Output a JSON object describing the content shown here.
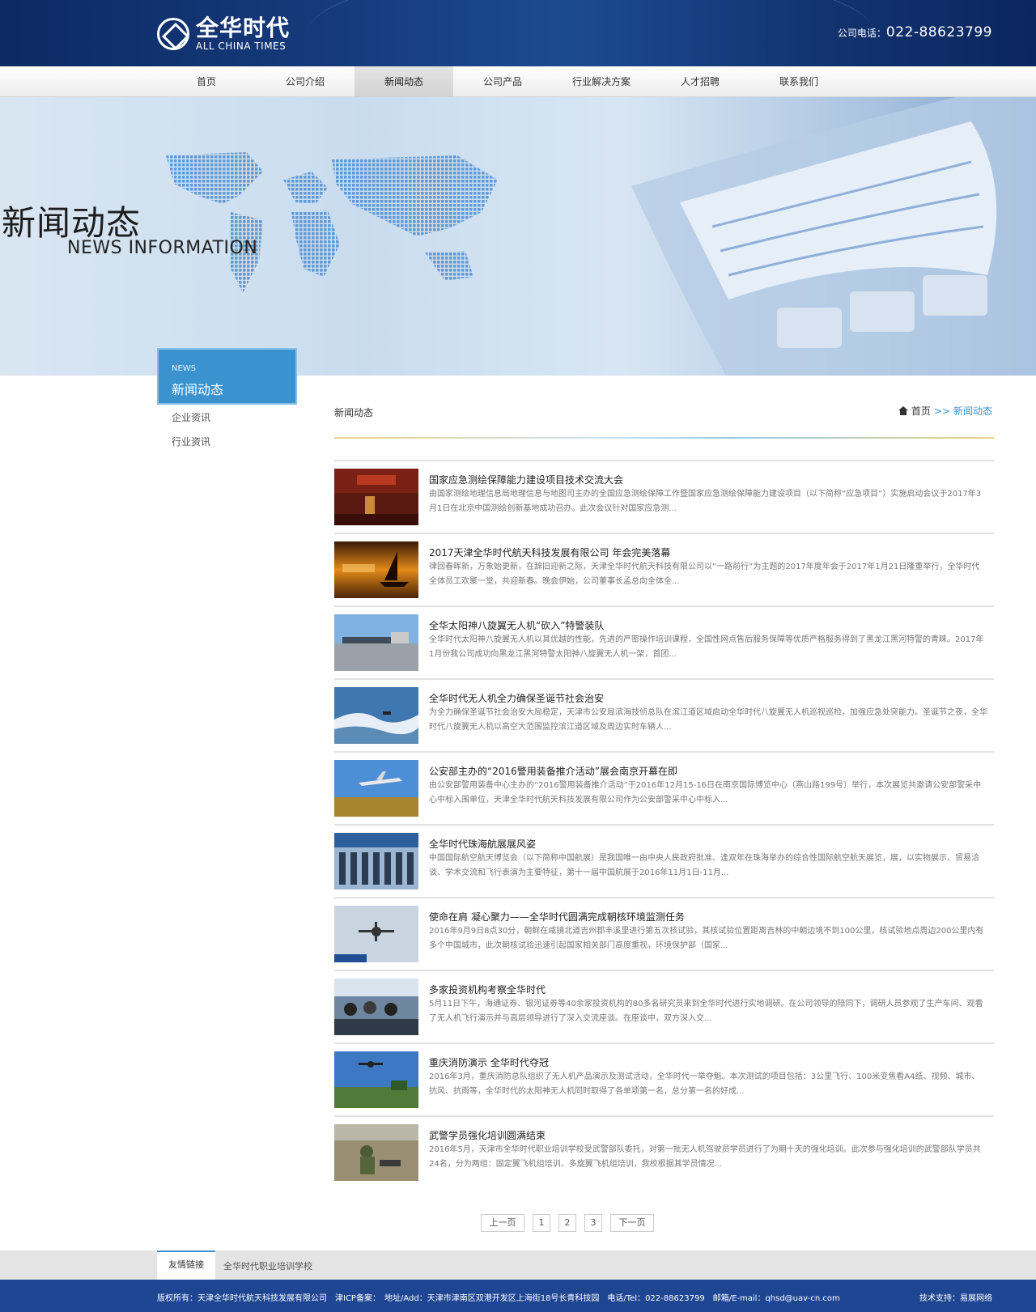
{
  "header": {
    "logo_cn": "全华时代",
    "logo_en": "ALL CHINA TIMES",
    "phone_label": "公司电话：",
    "phone_number": "022-88623799"
  },
  "nav": {
    "items": [
      {
        "label": "首页"
      },
      {
        "label": "公司介绍"
      },
      {
        "label": "新闻动态"
      },
      {
        "label": "公司产品"
      },
      {
        "label": "行业解决方案"
      },
      {
        "label": "人才招聘"
      },
      {
        "label": "联系我们"
      }
    ]
  },
  "banner": {
    "title_cn": "新闻动态",
    "title_en": "NEWS INFORMATION"
  },
  "sidebar": {
    "head_en": "NEWS",
    "head_cn": "新闻动态",
    "items": [
      {
        "label": "企业资讯"
      },
      {
        "label": "行业资讯"
      }
    ]
  },
  "content": {
    "section_title": "新闻动态",
    "breadcrumb": {
      "home": "首页",
      "sep": ">>",
      "current": "新闻动态"
    }
  },
  "news": [
    {
      "title": "国家应急测绘保障能力建设项目技术交流大会",
      "desc": "由国家测绘地理信息局地理信息与地图司主办的全国应急测绘保障工作暨国家应急测绘保障能力建设项目（以下简称“应急项目”）实施启动会议于2017年3月1日在北京中国测绘创新基地成功召办。此次会议针对国家应急测..."
    },
    {
      "title": "2017天津全华时代航天科技发展有限公司 年会完美落幕",
      "desc": "律回春晖新，万象始更新，在辞旧迎新之际，天津全华时代航天科技有限公司以“一路前行”为主题的2017年度年会于2017年1月21日隆重举行，全华时代全体员工欢聚一堂，共迎新春。晚会伊始，公司董事长孟总向全体全..."
    },
    {
      "title": "全华太阳神八旋翼无人机“砍入”特警装队",
      "desc": "全华时代太阳神八旋翼无人机以其优越的性能，先进的严密操作培训课程，全国性网点售后服务保障等优质严格服务得到了黑龙江黑河特警的青睐。2017年1月份我公司成功向黑龙江黑河特警太阳神八旋翼无人机一架，首团..."
    },
    {
      "title": "全华时代无人机全力确保圣诞节社会治安",
      "desc": "为全力确保圣诞节社会治安大局稳定，天津市公安局滨海技侦总队在滨江道区域启动全华时代八旋翼无人机巡视巡检，加强应急处突能力。圣诞节之夜，全华时代八旋翼无人机以高空大范围监控滨江道区域及周边实时车辆人..."
    },
    {
      "title": "公安部主办的“2016警用装备推介活动”展会南京开幕在即",
      "desc": "由公安部警用装备中心主办的“2016警用装备推介活动”于2016年12月15-16日在南京国际博览中心（燕山路199号）举行，本次展览共邀请公安部警采中心中标入围单位，天津全华时代航天科技发展有限公司作为公安部警采中心中标入..."
    },
    {
      "title": "全华时代珠海航展展风姿",
      "desc": "中国国际航空航天博览会（以下简称中国航展）是我国唯一由中央人民政府批准、逢双年在珠海举办的综合性国际航空航天展览，展，以实物展示、贸易洽谈、学术交流和飞行表演为主要特征，第十一届中国航展于2016年11月1日-11月..."
    },
    {
      "title": "使命在肩 凝心聚力——全华时代圆满完成朝核环境监测任务",
      "desc": "2016年9月9日8点30分，朝鲜在咸镜北道吉州郡丰溪里进行第五次核试验，其核试验位置距离吉林的中朝边境不到100公里，核试验地点周边200公里内有多个中国城市，此次朝核试验迅速引起国家相关部门高度重视，环境保护部（国家..."
    },
    {
      "title": "多家投资机构考察全华时代",
      "desc": "5月11日下午，海通证券、银河证券等40余家投资机构的80多名研究员来到全华时代进行实地调研。在公司领导的陪同下，调研人员参观了生产车间、观看了无人机飞行演示并与高层领导进行了深入交流座谈。在座谈中，双方深入交..."
    },
    {
      "title": "重庆消防演示 全华时代夺冠",
      "desc": "2016年3月，重庆消防总队组织了无人机产品演示及测试活动，全华时代一举夺魁。本次测试的项目包括：3公里飞行、100米变焦看A4纸、视频、城市、抗风、抗雨等，全华时代的太阳神无人机同时取得了各单项第一名，总分第一名的好成..."
    },
    {
      "title": "武警学员强化培训圆满结束",
      "desc": "2016年5月，天津市全华时代职业培训学校受武警部队委托，对第一批无人机驾驶员学员进行了为期十天的强化培训。此次参与强化培训的武警部队学员共24名，分为两组：固定翼飞机组培训、多旋翼飞机组培训，我校根据其学员情况..."
    }
  ],
  "pager": {
    "prev": "上一页",
    "pages": [
      "1",
      "2",
      "3"
    ],
    "next": "下一页"
  },
  "footer": {
    "links_tab": "友情链接",
    "link": "全华时代职业培训学校",
    "info": "版权所有：天津全华时代航天科技发展有限公司　津ICP备案：　地址/Add：天津市津南区双港开发区上海街18号长青科技园　电话/Tel：022-88623799　邮箱/E-mail：qhsd@uav-cn.com",
    "tech": "技术支持：易展网络"
  }
}
